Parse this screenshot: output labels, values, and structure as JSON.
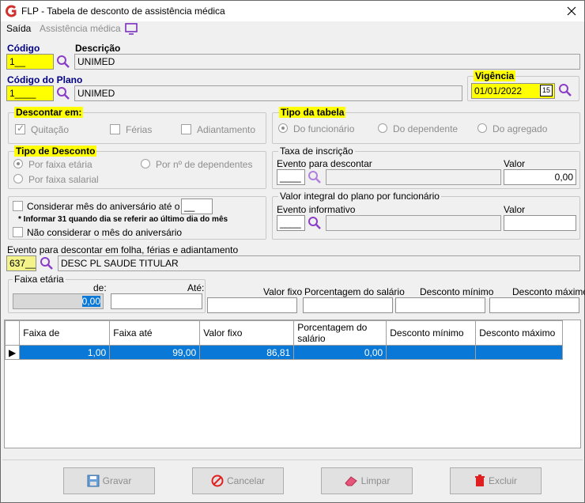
{
  "window": {
    "title": "FLP - Tabela de desconto de assistência médica"
  },
  "menu": {
    "exit": "Saída",
    "module": "Assistência médica"
  },
  "codigo": {
    "label": "Código",
    "value": "1__"
  },
  "descricao": {
    "label": "Descrição",
    "value": "UNIMED"
  },
  "codigo_plano": {
    "label": "Código do Plano",
    "value": "1____",
    "desc": "UNIMED"
  },
  "vigencia": {
    "label": "Vigência",
    "value": "01/01/2022"
  },
  "descontar_em": {
    "title": "Descontar em:",
    "options": [
      "Quitação",
      "Férias",
      "Adiantamento"
    ]
  },
  "tipo_tabela": {
    "title": "Tipo da tabela",
    "options": [
      "Do funcionário",
      "Do dependente",
      "Do agregado"
    ]
  },
  "tipo_desconto": {
    "title": "Tipo de Desconto",
    "opt1": "Por faixa etária",
    "opt2": "Por faixa salarial",
    "opt3": "Por nº de dependentes"
  },
  "taxa": {
    "title": "Taxa de inscrição",
    "evento_label": "Evento para descontar",
    "evento_value": "____",
    "valor_label": "Valor",
    "valor_value": "0,00"
  },
  "aniversario": {
    "opt1": "Considerar mês do aniversário até o dia",
    "dia": "__",
    "note": "* Informar 31 quando dia se referir ao último dia do mês",
    "opt2": "Não considerar o mês do aniversário"
  },
  "valor_integral": {
    "title": "Valor integral do plano por funcionário",
    "evento_label": "Evento informativo",
    "evento_value": "____",
    "valor_label": "Valor"
  },
  "evento_folha": {
    "label": "Evento para descontar em folha, férias e adiantamento",
    "code": "637__",
    "desc": "DESC PL SAUDE TITULAR"
  },
  "faixa": {
    "title": "Faixa etária",
    "de_label": "de:",
    "de_value": "0,00",
    "ate_label": "Até:"
  },
  "valor_fixo_label": "Valor fixo",
  "porcentagem_label": "Porcentagem do salário",
  "desc_min_label": "Desconto mínimo",
  "desc_max_label": "Desconto máximo",
  "grid": {
    "columns": [
      "Faixa de",
      "Faixa até",
      "Valor fixo",
      "Porcentagem do salário",
      "Desconto mínimo",
      "Desconto máximo"
    ],
    "rows": [
      [
        "1,00",
        "99,00",
        "86,81",
        "0,00",
        "",
        ""
      ]
    ]
  },
  "buttons": {
    "save": "Gravar",
    "cancel": "Cancelar",
    "clear": "Limpar",
    "delete": "Excluir"
  }
}
